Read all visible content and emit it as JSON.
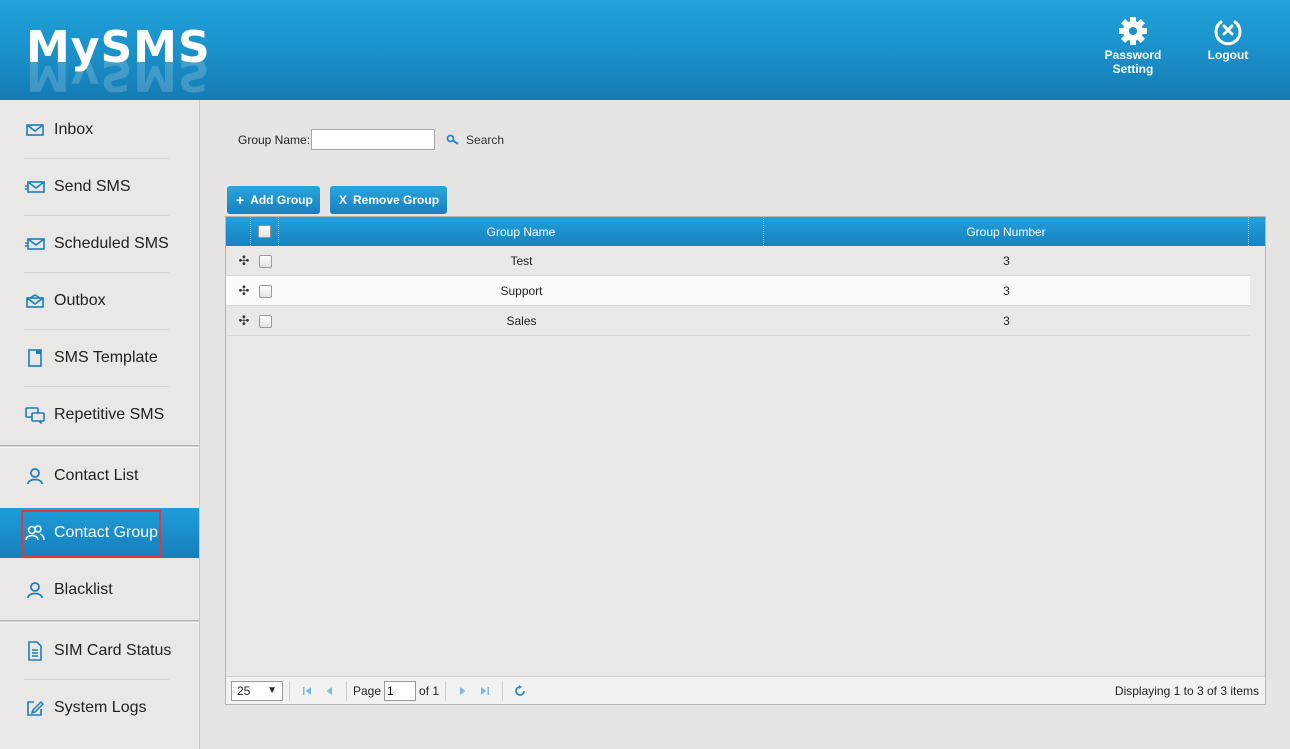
{
  "header": {
    "logo": "MySMS",
    "password_setting": "Password Setting",
    "password_setting_line1": "Password",
    "password_setting_line2": "Setting",
    "logout": "Logout"
  },
  "sidebar": {
    "items": [
      {
        "label": "Inbox",
        "icon": "envelope-icon"
      },
      {
        "label": "Send SMS",
        "icon": "envelope-send-icon"
      },
      {
        "label": "Scheduled SMS",
        "icon": "envelope-clock-icon"
      },
      {
        "label": "Outbox",
        "icon": "envelope-open-icon"
      },
      {
        "label": "SMS Template",
        "icon": "template-icon"
      },
      {
        "label": "Repetitive SMS",
        "icon": "chat-bubbles-icon"
      },
      {
        "label": "Contact List",
        "icon": "user-icon"
      },
      {
        "label": "Contact Group",
        "icon": "users-icon",
        "active": true
      },
      {
        "label": "Blacklist",
        "icon": "user-block-icon"
      },
      {
        "label": "SIM Card Status",
        "icon": "document-icon"
      },
      {
        "label": "System Logs",
        "icon": "edit-icon"
      }
    ]
  },
  "search": {
    "label": "Group Name:",
    "value": "",
    "button": "Search"
  },
  "toolbar": {
    "add_label": "Add Group",
    "remove_label": "Remove Group"
  },
  "grid": {
    "columns": [
      "Group Name",
      "Group Number"
    ],
    "rows": [
      {
        "name": "Test",
        "number": "3"
      },
      {
        "name": "Support",
        "number": "3"
      },
      {
        "name": "Sales",
        "number": "3"
      }
    ]
  },
  "pager": {
    "page_size": "25",
    "page_label": "Page",
    "page_value": "1",
    "of_label": "of 1",
    "info": "Displaying 1 to 3 of 3 items"
  },
  "colors": {
    "accent": "#1a8fc8",
    "active_outline": "#e0393b"
  }
}
